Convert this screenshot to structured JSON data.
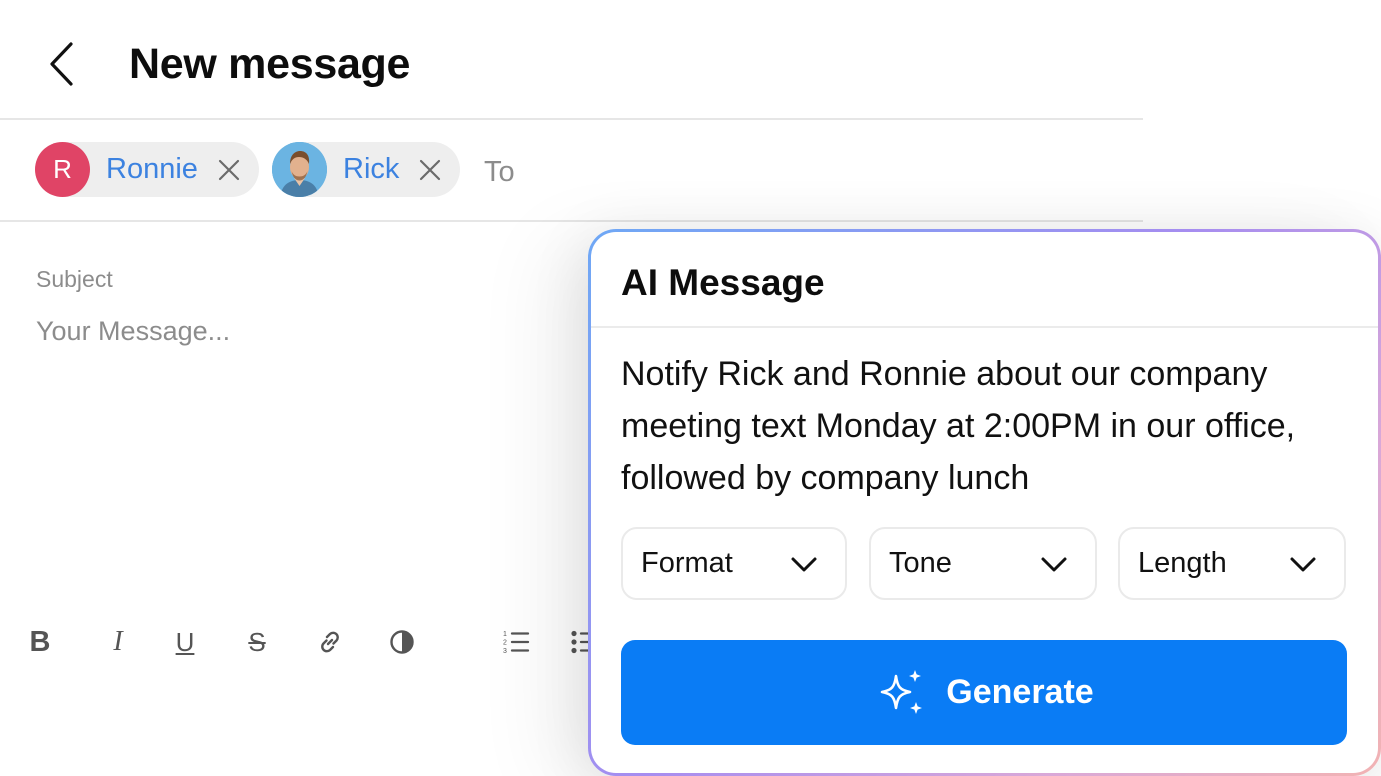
{
  "header": {
    "title": "New message",
    "back_icon": "chevron-left-icon"
  },
  "recipients": {
    "chips": [
      {
        "name": "Ronnie",
        "avatar_letter": "R",
        "avatar_color": "#e04466"
      },
      {
        "name": "Rick",
        "avatar_type": "photo"
      }
    ],
    "to_placeholder": "To"
  },
  "compose": {
    "subject_placeholder": "Subject",
    "message_placeholder": "Your Message..."
  },
  "toolbar": {
    "bold_label": "B",
    "italic_label": "I",
    "underline_label": "U",
    "strike_label": "S",
    "icons": [
      "bold-icon",
      "italic-icon",
      "underline-icon",
      "strikethrough-icon",
      "link-icon",
      "contrast-icon",
      "numbered-list-icon",
      "bulleted-list-icon"
    ]
  },
  "ai_panel": {
    "title": "AI Message",
    "prompt": "Notify Rick and Ronnie about our company meeting text Monday at 2:00PM in our office, followed by company lunch",
    "selects": {
      "format": "Format",
      "tone": "Tone",
      "length": "Length"
    },
    "generate_label": "Generate",
    "generate_icon": "sparkles-icon"
  },
  "colors": {
    "accent": "#0a7cf5",
    "chip_text": "#3c82e0",
    "avatar_ronnie": "#e04466"
  }
}
